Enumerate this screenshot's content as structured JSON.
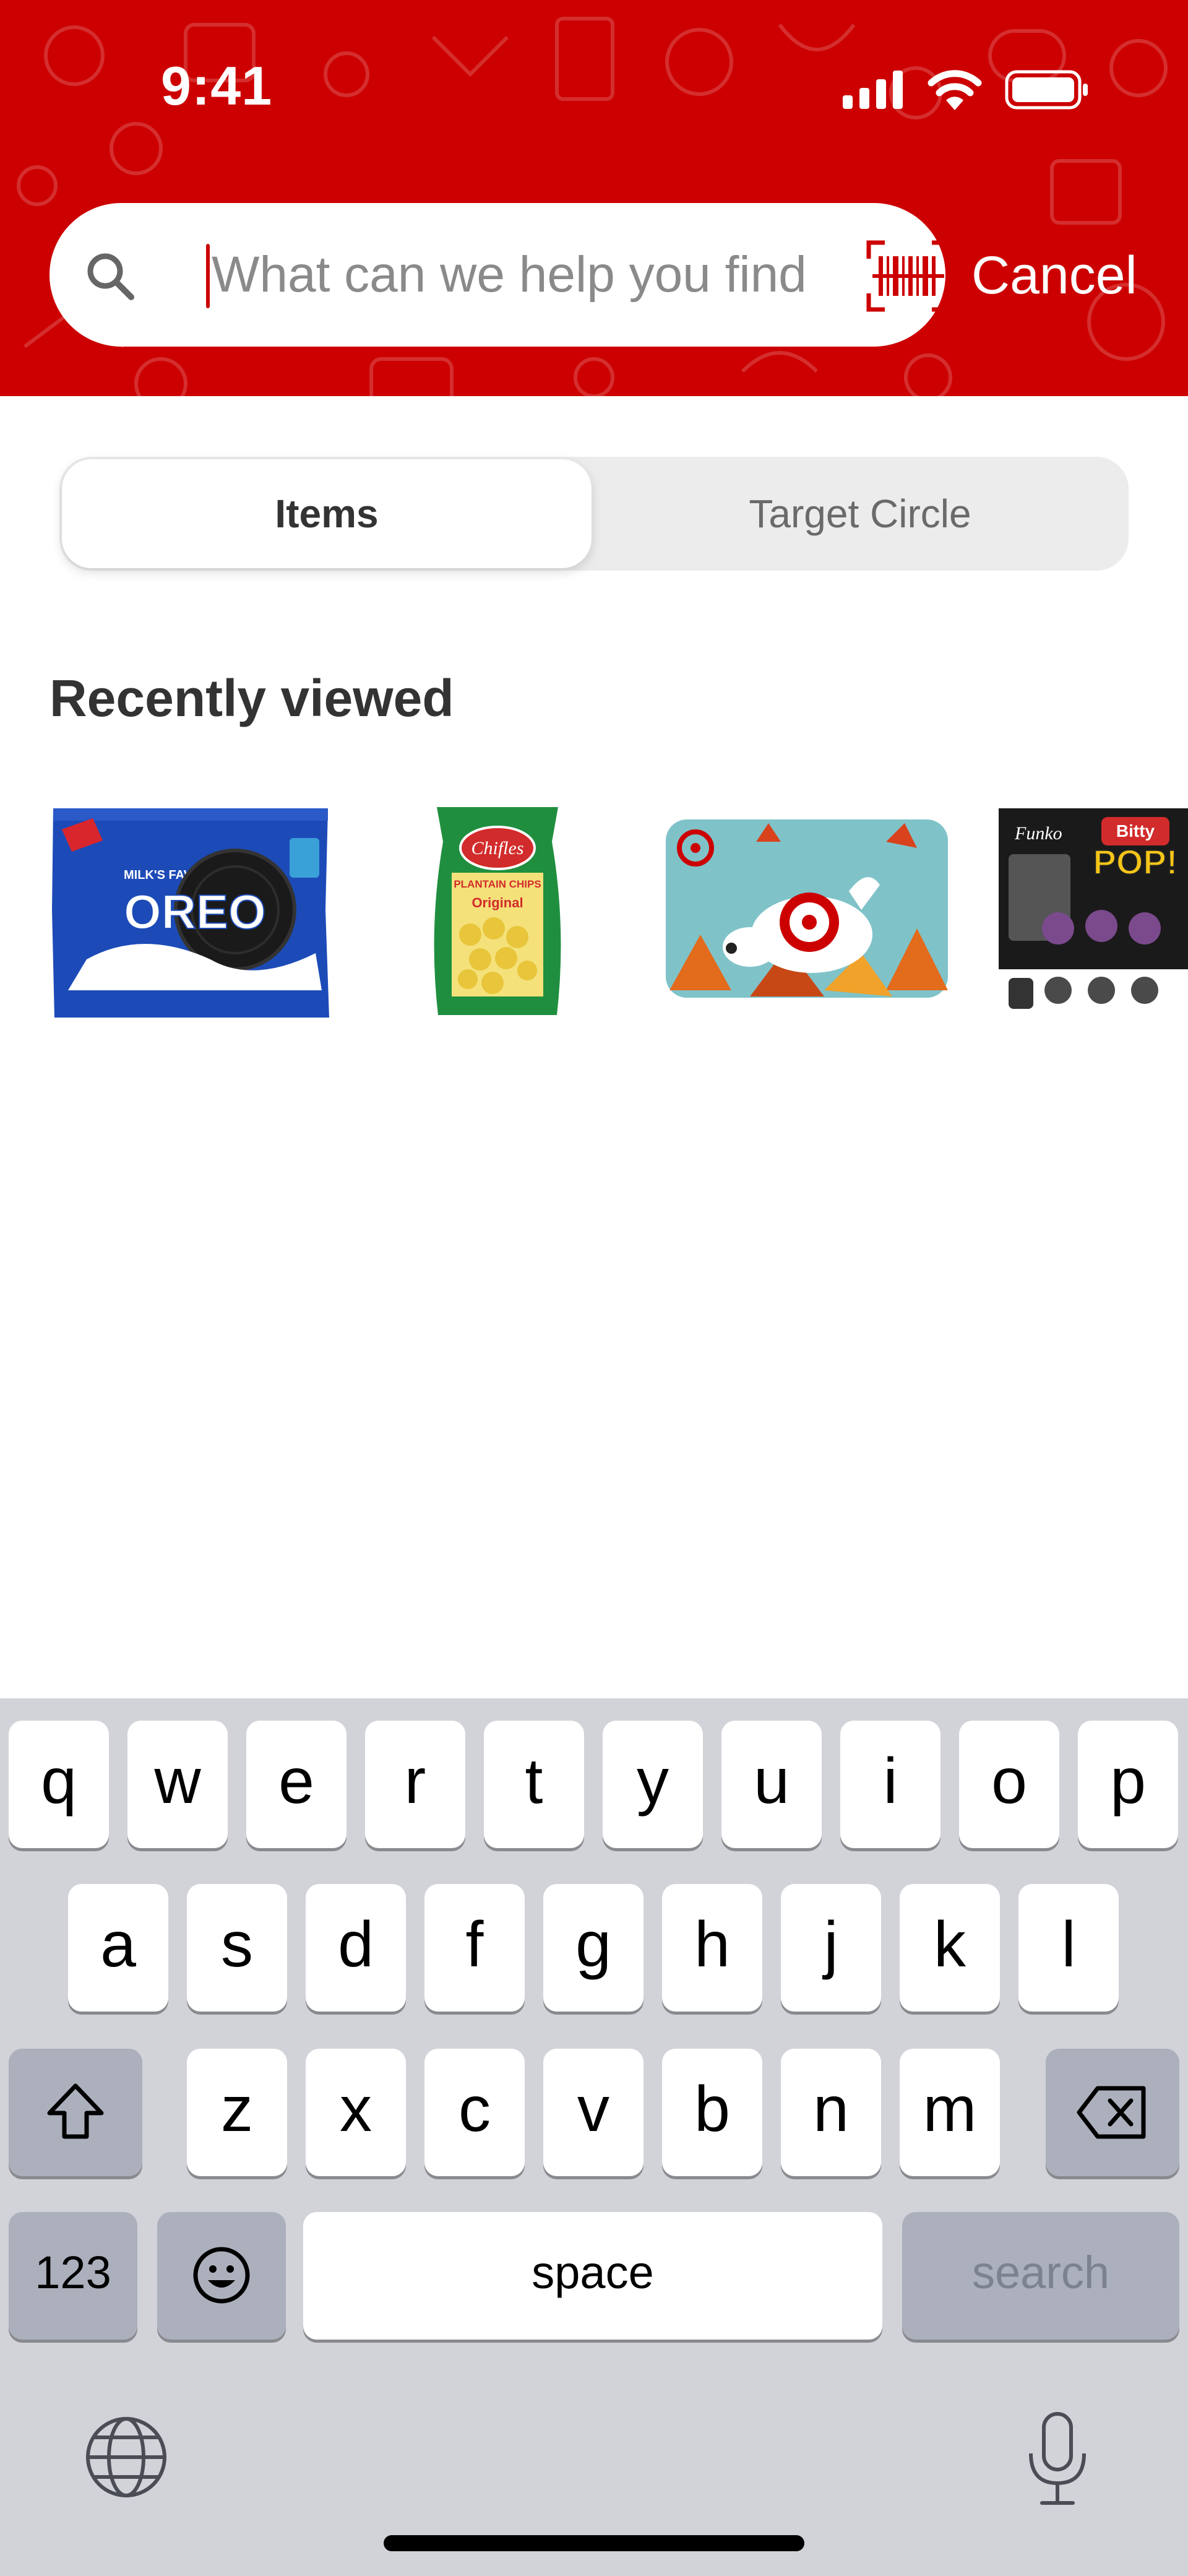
{
  "status_bar": {
    "time": "9:41"
  },
  "search": {
    "placeholder": "What can we help you find?",
    "value": "",
    "cancel_label": "Cancel"
  },
  "segmented": {
    "tabs": [
      {
        "label": "Items",
        "active": true
      },
      {
        "label": "Target Circle",
        "active": false
      }
    ]
  },
  "recently_viewed": {
    "title": "Recently viewed",
    "items": [
      {
        "label": "MILK'S FAVORITE COOKIE",
        "brand": "OREO"
      },
      {
        "label": "PLANTAIN CHIPS",
        "brand": "Chifles",
        "variant": "Original"
      },
      {
        "label": "gift-card-bullseye"
      },
      {
        "brand": "Funko",
        "label": "Bitty",
        "variant": "POP!"
      }
    ]
  },
  "keyboard": {
    "row1": [
      "q",
      "w",
      "e",
      "r",
      "t",
      "y",
      "u",
      "i",
      "o",
      "p"
    ],
    "row2": [
      "a",
      "s",
      "d",
      "f",
      "g",
      "h",
      "j",
      "k",
      "l"
    ],
    "row3": [
      "z",
      "x",
      "c",
      "v",
      "b",
      "n",
      "m"
    ],
    "numbers_label": "123",
    "space_label": "space",
    "search_label": "search"
  },
  "colors": {
    "brand_red": "#cc0000",
    "keyboard_bg": "#d1d3d9"
  },
  "icons": [
    "search-icon",
    "barcode-icon",
    "shift-icon",
    "backspace-icon",
    "emoji-icon",
    "globe-icon",
    "microphone-icon"
  ]
}
